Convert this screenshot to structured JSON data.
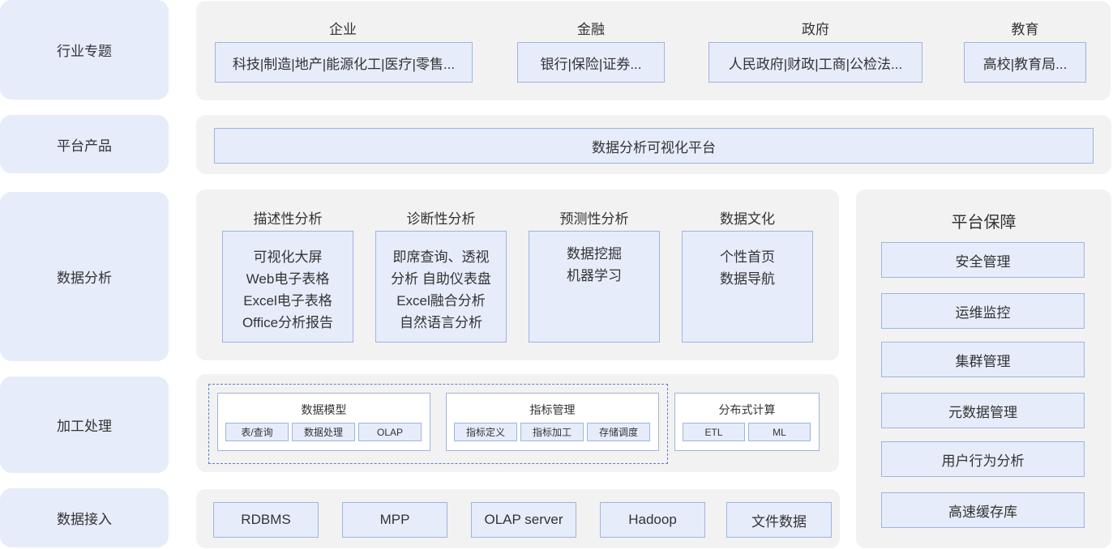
{
  "rows": {
    "industry": "行业专题",
    "platform": "平台产品",
    "analysis": "数据分析",
    "processing": "加工处理",
    "ingestion": "数据接入"
  },
  "industry": {
    "groups": [
      {
        "title": "企业",
        "items": "科技|制造|地产|能源化工|医疗|零售..."
      },
      {
        "title": "金融",
        "items": "银行|保险|证券..."
      },
      {
        "title": "政府",
        "items": "人民政府|财政|工商|公检法..."
      },
      {
        "title": "教育",
        "items": "高校|教育局..."
      }
    ]
  },
  "platform": {
    "product": "数据分析可视化平台"
  },
  "analysis": {
    "columns": [
      {
        "title": "描述性分析",
        "lines": [
          "可视化大屏",
          "Web电子表格",
          "Excel电子表格",
          "Office分析报告"
        ]
      },
      {
        "title": "诊断性分析",
        "lines": [
          "即席查询、透视",
          "分析 自助仪表盘",
          "Excel融合分析",
          "自然语言分析"
        ]
      },
      {
        "title": "预测性分析",
        "lines": [
          "数据挖掘",
          "机器学习"
        ]
      },
      {
        "title": "数据文化",
        "lines": [
          "个性首页",
          "数据导航"
        ]
      }
    ]
  },
  "processing": {
    "modules": [
      {
        "title": "数据模型",
        "items": [
          "表/查询",
          "数据处理",
          "OLAP"
        ]
      },
      {
        "title": "指标管理",
        "items": [
          "指标定义",
          "指标加工",
          "存储调度"
        ]
      },
      {
        "title": "分布式计算",
        "items": [
          "ETL",
          "ML"
        ]
      }
    ]
  },
  "ingestion": {
    "sources": [
      "RDBMS",
      "MPP",
      "OLAP server",
      "Hadoop",
      "文件数据"
    ]
  },
  "guarantee": {
    "title": "平台保障",
    "items": [
      "安全管理",
      "运维监控",
      "集群管理",
      "元数据管理",
      "用户行为分析",
      "高速缓存库"
    ]
  }
}
